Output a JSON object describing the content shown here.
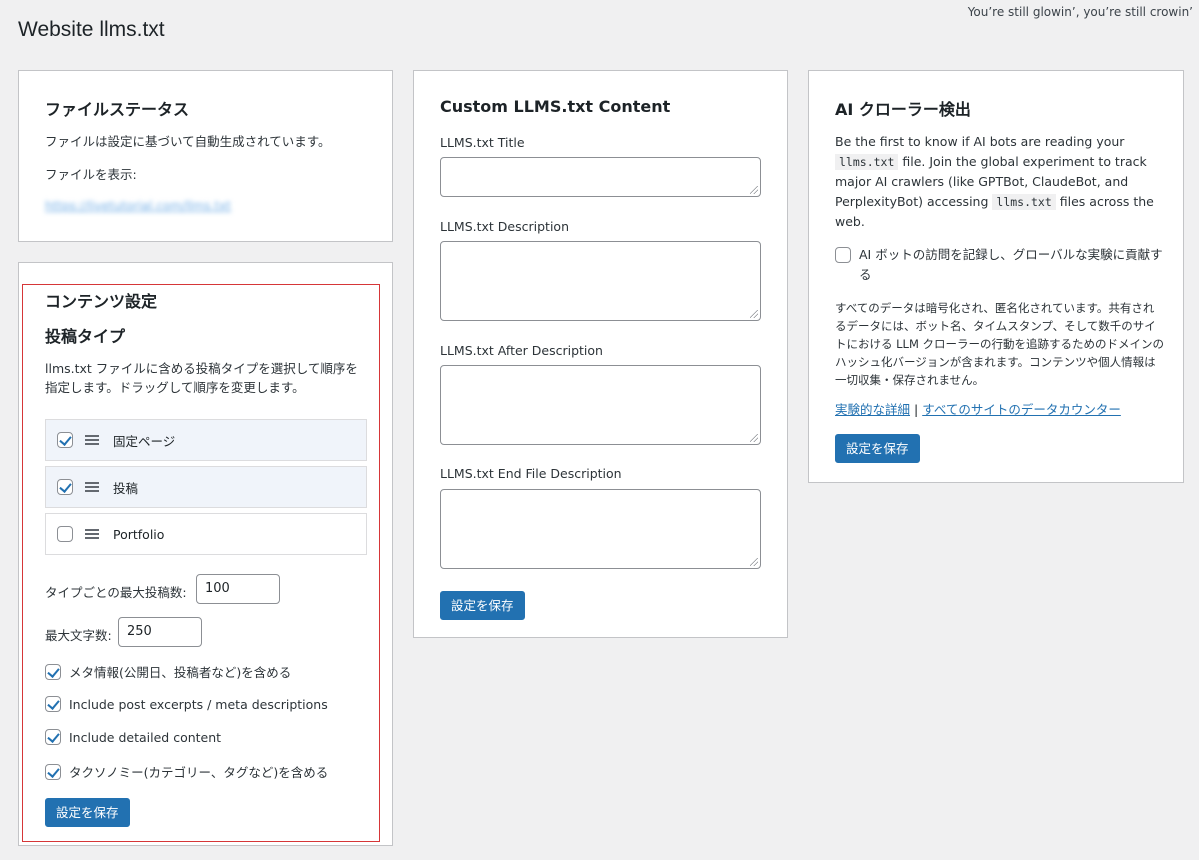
{
  "header": {
    "top_note": "You’re still glowin’, you’re still crowin’",
    "page_title": "Website llms.txt"
  },
  "file_status": {
    "heading": "ファイルステータス",
    "auto_text": "ファイルは設定に基づいて自動生成されています。",
    "view_label": "ファイルを表示:",
    "file_url": "https://livetutorial.com/llms.txt"
  },
  "content_settings": {
    "heading": "コンテンツ設定",
    "sub_heading": "投稿タイプ",
    "description": "llms.txt ファイルに含める投稿タイプを選択して順序を指定します。ドラッグして順序を変更します。",
    "post_types": [
      {
        "label": "固定ページ",
        "checked": true
      },
      {
        "label": "投稿",
        "checked": true
      },
      {
        "label": "Portfolio",
        "checked": false
      }
    ],
    "max_posts_label": "タイプごとの最大投稿数:",
    "max_posts_value": "100",
    "max_words_label": "最大文字数:",
    "max_words_value": "250",
    "options": [
      {
        "label": "メタ情報(公開日、投稿者など)を含める",
        "checked": true
      },
      {
        "label": "Include post excerpts / meta descriptions",
        "checked": true
      },
      {
        "label": "Include detailed content",
        "checked": true
      },
      {
        "label": "タクソノミー(カテゴリー、タグなど)を含める",
        "checked": true
      }
    ],
    "save_label": "設定を保存"
  },
  "custom_content": {
    "heading": "Custom LLMS.txt Content",
    "title_label": "LLMS.txt Title",
    "description_label": "LLMS.txt Description",
    "after_description_label": "LLMS.txt After Description",
    "end_description_label": "LLMS.txt End File Description",
    "save_label": "設定を保存"
  },
  "ai_crawler": {
    "heading": "AI クローラー検出",
    "intro_1": "Be the first to know if AI bots are reading your",
    "intro_code_1": "llms.txt",
    "intro_2": "file. Join the global experiment to track major AI crawlers (like GPTBot, ClaudeBot, and PerplexityBot) accessing",
    "intro_code_2": "llms.txt",
    "intro_3": "files across the web.",
    "checkbox_label": "AI ボットの訪問を記録し、グローバルな実験に貢献する",
    "checkbox_checked": false,
    "privacy_text": "すべてのデータは暗号化され、匿名化されています。共有されるデータには、ボット名、タイムスタンプ、そして数千のサイトにおける LLM クローラーの行動を追跡するためのドメインのハッシュ化バージョンが含まれます。コンテンツや個人情報は一切収集・保存されません。",
    "link_details": "実験的な詳細",
    "link_separator": "|",
    "link_counter": "すべてのサイトのデータカウンター",
    "save_label": "設定を保存"
  },
  "colors": {
    "accent": "#2271b1",
    "background": "#f0f0f1",
    "highlight_border": "#d63638"
  }
}
